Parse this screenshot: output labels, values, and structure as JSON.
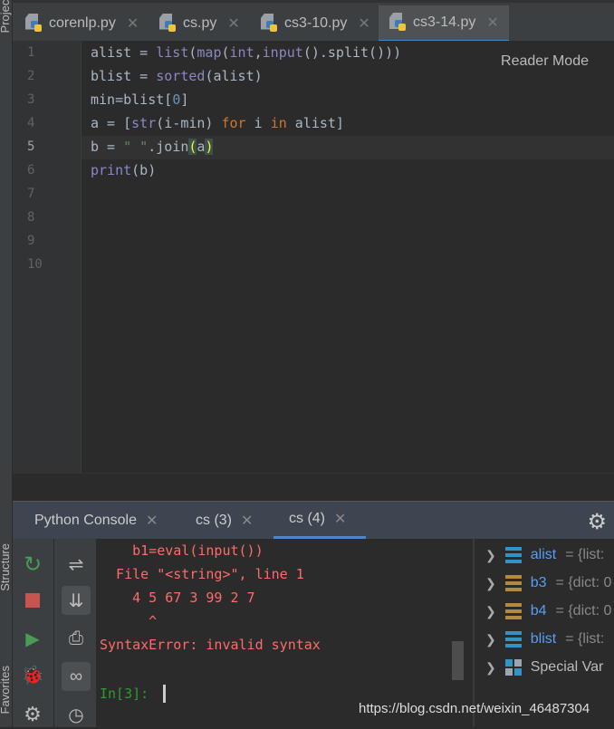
{
  "side_strip": {
    "project": "Project",
    "structure": "Structure",
    "favorites": "Favorites"
  },
  "editor_tabs": [
    {
      "label": "corenlp.py"
    },
    {
      "label": "cs.py"
    },
    {
      "label": "cs3-10.py"
    },
    {
      "label": "cs3-14.py",
      "active": true
    }
  ],
  "reader_mode": "Reader Mode",
  "line_numbers": [
    "1",
    "2",
    "3",
    "4",
    "5",
    "6",
    "7",
    "8",
    "9",
    "10"
  ],
  "current_line": 5,
  "code_lines": [
    "alist = list(map(int,input().split()))",
    "blist = sorted(alist)",
    "min=blist[0]",
    "a = [str(i-min) for i in alist]",
    "b = \" \".join(a)",
    "print(b)"
  ],
  "console_tabs": [
    {
      "label": "Python Console"
    },
    {
      "label": "cs (3)"
    },
    {
      "label": "cs (4)",
      "active": true
    }
  ],
  "console_lines": [
    "    b1=eval(input())",
    "  File \"<string>\", line 1",
    "    4 5 67 3 99 2 7",
    "      ^",
    "SyntaxError: invalid syntax"
  ],
  "prompt": "In[3]:",
  "variables": [
    {
      "name": "alist",
      "value": "= {list: ",
      "type": "list"
    },
    {
      "name": "b3",
      "value": "= {dict: 0",
      "type": "dict"
    },
    {
      "name": "b4",
      "value": "= {dict: 0",
      "type": "dict"
    },
    {
      "name": "blist",
      "value": "= {list: ",
      "type": "list"
    },
    {
      "name": "",
      "value": "Special Var",
      "type": "special"
    }
  ],
  "watermark": "https://blog.csdn.net/weixin_46487304",
  "colors": {
    "keyword": "#cc7832",
    "builtin": "#8888c6",
    "number": "#6897bb",
    "string": "#6a8759",
    "error": "#ff6b68",
    "prompt": "#2e9b2e",
    "accent": "#4a88c7"
  }
}
